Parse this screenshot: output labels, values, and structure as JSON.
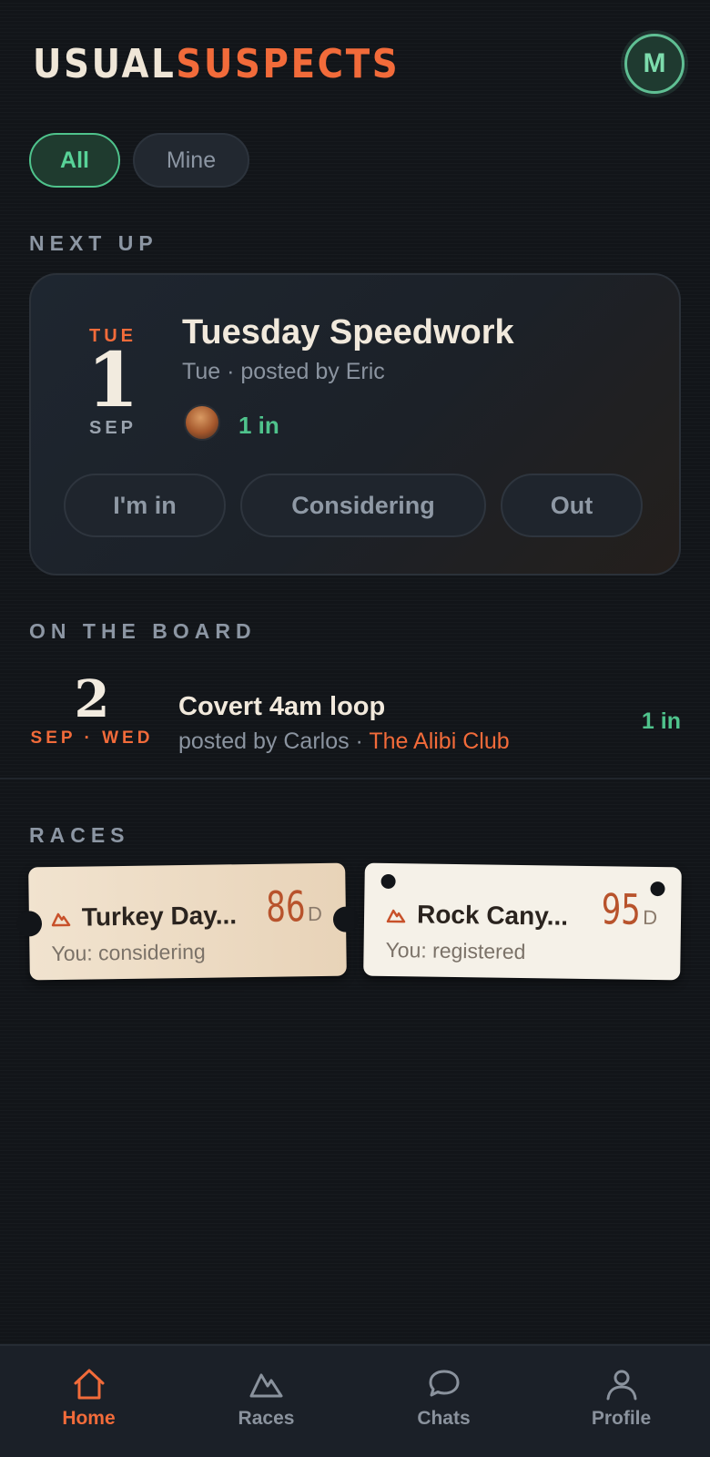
{
  "header": {
    "logo_part1": "USUAL",
    "logo_part2": "SUSPECTS",
    "avatar_initial": "M"
  },
  "filters": [
    {
      "label": "All",
      "active": true
    },
    {
      "label": "Mine",
      "active": false
    }
  ],
  "next_up": {
    "section_label": "NEXT UP",
    "day_of_week": "TUE",
    "day": "1",
    "month": "SEP",
    "title": "Tuesday Speedwork",
    "subtitle": "Tue · posted by Eric",
    "count": "1 in",
    "rsvp": [
      "I'm in",
      "Considering",
      "Out"
    ]
  },
  "board": {
    "section_label": "ON THE BOARD",
    "items": [
      {
        "day": "2",
        "meta": "SEP · WED",
        "title": "Covert 4am loop",
        "posted": "posted by Carlos · ",
        "club": "The Alibi Club",
        "count": "1 in"
      }
    ]
  },
  "races": {
    "section_label": "RACES",
    "items": [
      {
        "title": "Turkey Day...",
        "status": "You: considering",
        "days": "86",
        "unit": "D"
      },
      {
        "title": "Rock Cany...",
        "status": "You: registered",
        "days": "95",
        "unit": "D"
      }
    ]
  },
  "nav": {
    "items": [
      {
        "label": "Home",
        "icon": "home-icon",
        "active": true
      },
      {
        "label": "Races",
        "icon": "mountain-icon",
        "active": false
      },
      {
        "label": "Chats",
        "icon": "chat-bubble-icon",
        "active": false
      },
      {
        "label": "Profile",
        "icon": "person-icon",
        "active": false
      }
    ]
  },
  "colors": {
    "accent_orange": "#f26b3a",
    "accent_green": "#4fc38c",
    "background": "#121519"
  }
}
